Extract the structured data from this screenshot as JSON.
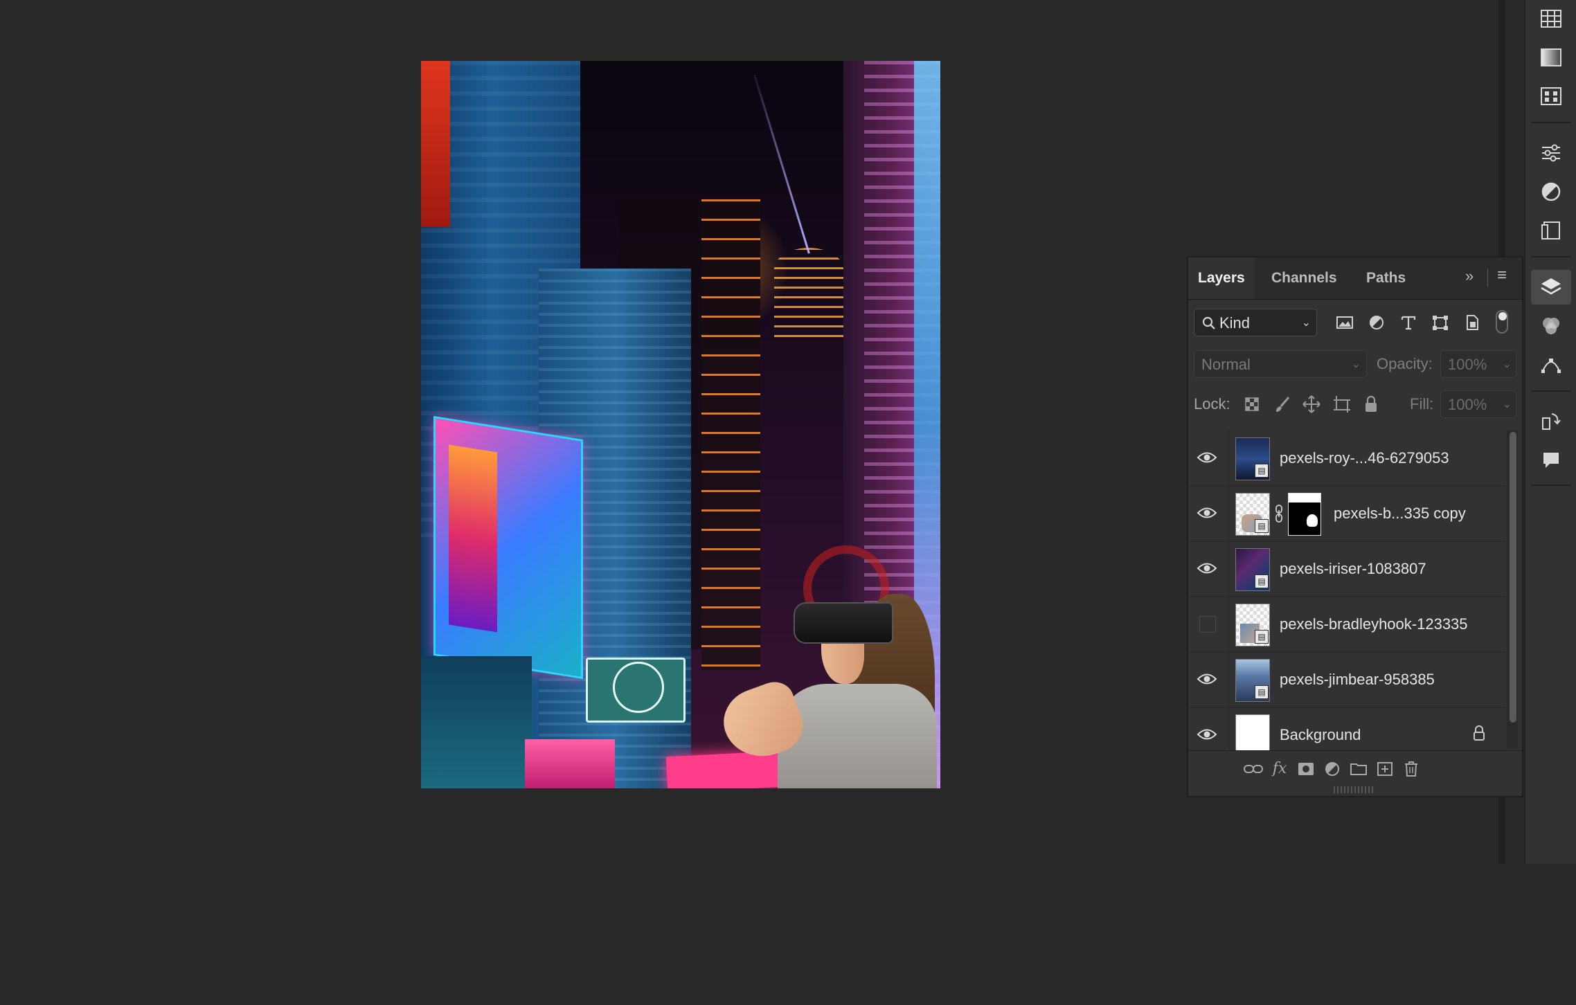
{
  "panel": {
    "tabs": [
      {
        "label": "Layers"
      },
      {
        "label": "Channels"
      },
      {
        "label": "Paths"
      }
    ],
    "collapse_icon": "double-chevron-right-icon",
    "menu_icon": "hamburger-menu-icon"
  },
  "filter": {
    "kind_label": "Kind",
    "icons": [
      "image-filter-icon",
      "adjustment-filter-icon",
      "type-filter-icon",
      "shape-filter-icon",
      "smart-object-filter-icon"
    ]
  },
  "blend": {
    "mode": "Normal",
    "opacity_label": "Opacity:",
    "opacity_value": "100%"
  },
  "lock": {
    "label": "Lock:",
    "fill_label": "Fill:",
    "fill_value": "100%"
  },
  "layers": [
    {
      "name": "pexels-roy-...46-6279053",
      "visible": true
    },
    {
      "name": "pexels-b...335 copy",
      "visible": true,
      "has_mask": true
    },
    {
      "name": "pexels-iriser-1083807",
      "visible": true
    },
    {
      "name": "pexels-bradleyhook-123335",
      "visible": false
    },
    {
      "name": "pexels-jimbear-958385",
      "visible": true
    },
    {
      "name": "Background",
      "visible": true,
      "locked": true
    }
  ],
  "footer_icons": [
    "link-layers-icon",
    "fx-icon",
    "add-mask-icon",
    "adjustment-layer-icon",
    "new-group-icon",
    "new-layer-icon",
    "trash-icon"
  ],
  "colors": {
    "background": "#282828",
    "panel": "#323232",
    "accent_active_tool": "#4a4a4a"
  }
}
